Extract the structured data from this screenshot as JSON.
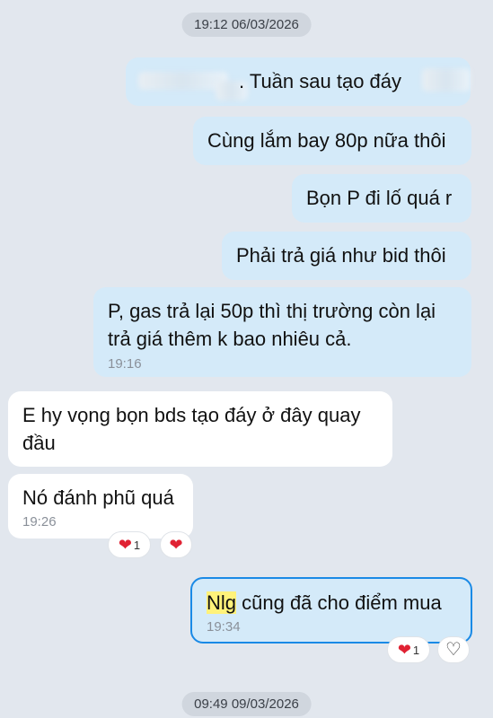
{
  "date_separators": [
    "19:12 06/03/2026",
    "09:49 09/03/2026"
  ],
  "messages": [
    {
      "text": ". Tuần sau tạo đáy"
    },
    {
      "text": "Cùng lắm bay 80p nữa thôi"
    },
    {
      "text": "Bọn P đi lố quá r"
    },
    {
      "text": "Phải trả giá như bid thôi"
    },
    {
      "line1": "P, gas trả lại 50p thì thị trường còn lại",
      "line2": "trả giá thêm k bao nhiêu cả.",
      "time": "19:16"
    },
    {
      "line1": "E hy vọng bọn bds tạo đáy ở đây quay",
      "line2": "đầu"
    },
    {
      "text": "Nó đánh phũ quá",
      "time": "19:26",
      "reaction_count": "1",
      "heart_glyph": "❤",
      "add_heart_glyph": "❤"
    },
    {
      "highlight": "Nlg",
      "text": " cũng đã cho điểm mua",
      "time": "19:34",
      "reaction_count": "1",
      "heart_glyph": "❤",
      "outline_glyph": "♡"
    }
  ],
  "colors": {
    "outgoing": "#d4eaf9",
    "incoming": "#ffffff",
    "reaction": "#e02233",
    "selected_border": "#1a8ae6"
  },
  "icons": [
    "heart-reaction-icon",
    "add-heart-reaction-icon",
    "heart-outline-icon"
  ]
}
